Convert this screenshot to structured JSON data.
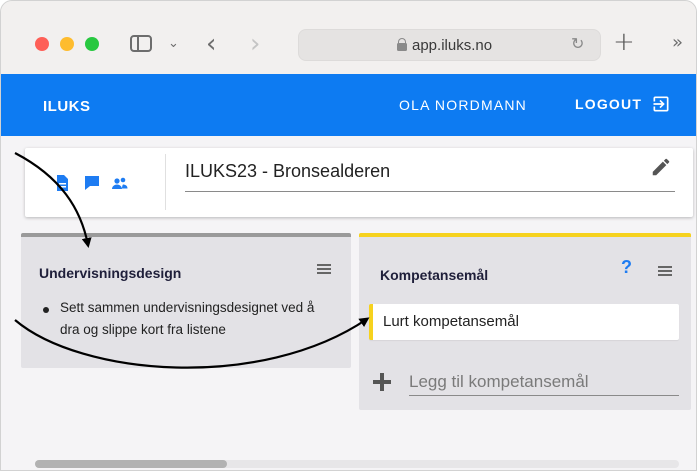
{
  "browser": {
    "url": "app.iluks.no",
    "icons": [
      "sidebar-toggle-icon",
      "chevron-down-icon",
      "back-icon",
      "forward-icon",
      "lock-icon",
      "reload-icon",
      "new-tab-icon",
      "more-tabs-icon"
    ]
  },
  "header": {
    "brand": "ILUKS",
    "user": "OLA NORDMANN",
    "logout_label": "LOGOUT"
  },
  "project": {
    "title": "ILUKS23 - Bronsealderen",
    "icons": [
      "document-icon",
      "comment-icon",
      "people-icon",
      "edit-icon"
    ]
  },
  "columns": {
    "design": {
      "title": "Undervisningsdesign",
      "hint": "Sett sammen undervisningsdesignet ved å dra og slippe kort fra listene"
    },
    "goals": {
      "title": "Kompetansemål",
      "help": "?",
      "cards": [
        {
          "text": "Lurt kompetansemål"
        }
      ],
      "add_placeholder": "Legg til kompetansemål"
    }
  },
  "colors": {
    "app_blue": "#0d7bf2",
    "goal_yellow": "#f6d21e",
    "design_grey": "#9a9a9a",
    "column_bg": "#e3e2e6"
  }
}
